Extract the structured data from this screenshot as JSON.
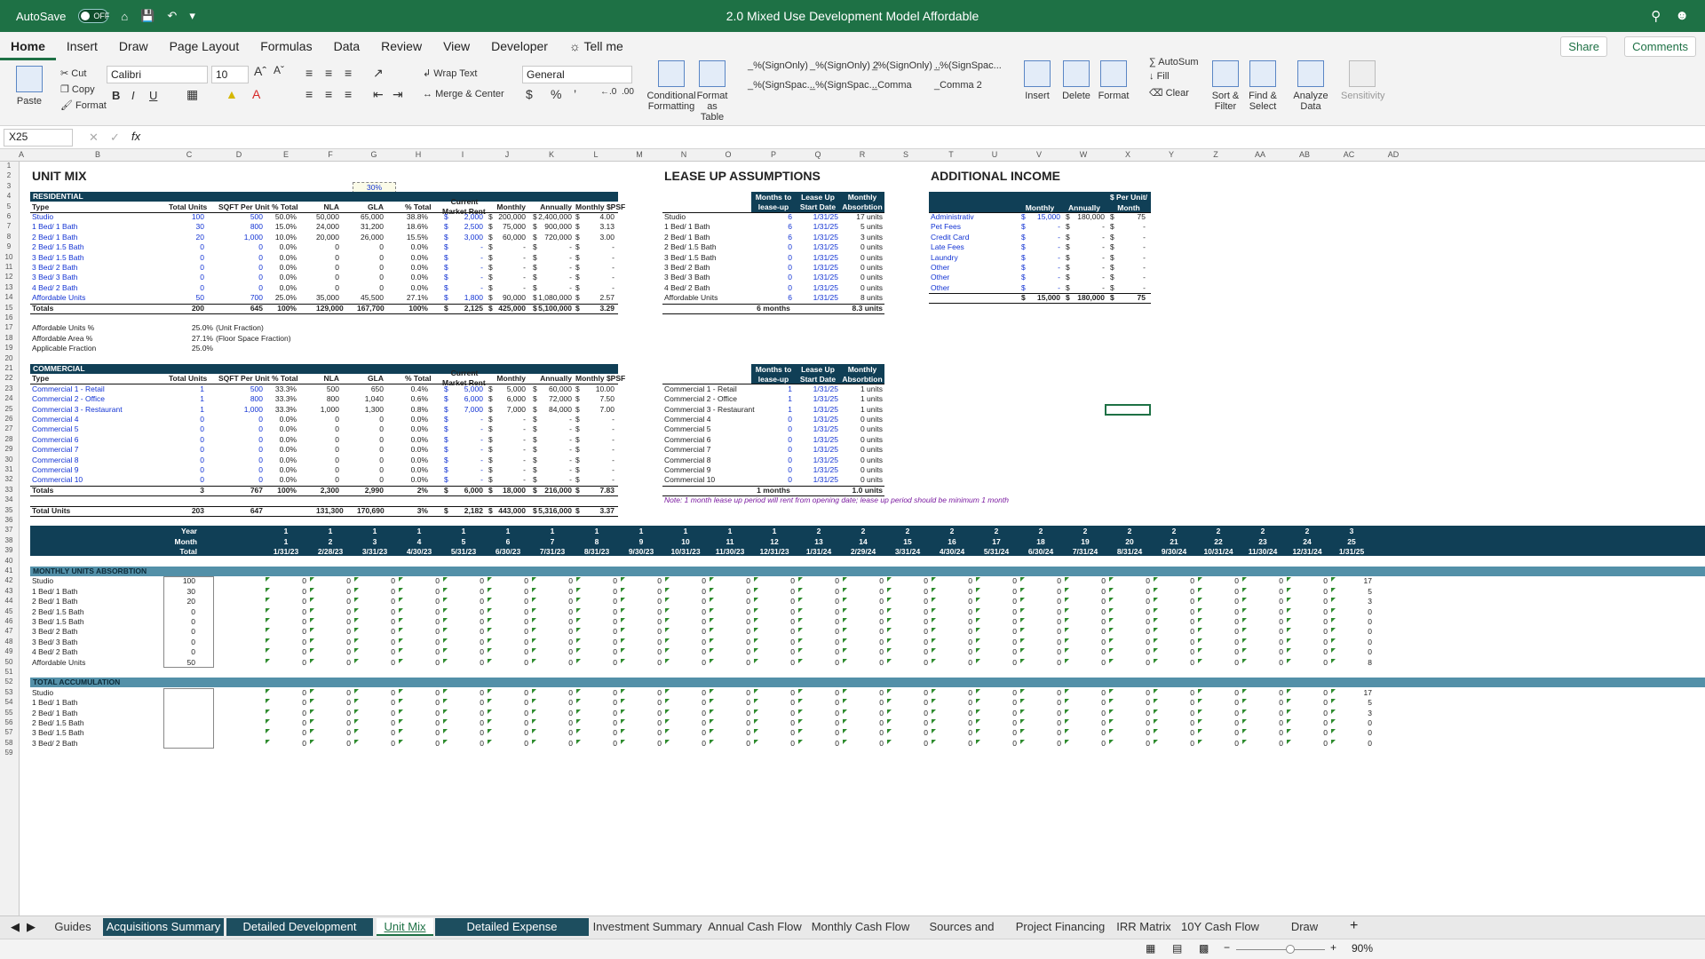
{
  "titlebar": {
    "autosave_label": "AutoSave",
    "autosave_state": "OFF",
    "document_title": "2.0 Mixed Use Development Model Affordable"
  },
  "menu": {
    "tabs": [
      "Home",
      "Insert",
      "Draw",
      "Page Layout",
      "Formulas",
      "Data",
      "Review",
      "View",
      "Developer"
    ],
    "tell_me": "Tell me",
    "share": "Share",
    "comments": "Comments"
  },
  "ribbon": {
    "paste": "Paste",
    "cut": "Cut",
    "copy": "Copy",
    "format": "Format",
    "font_name": "Calibri",
    "font_size": "10",
    "wrap_text": "Wrap Text",
    "merge_center": "Merge & Center",
    "number_format": "General",
    "conditional_formatting": [
      "Conditional",
      "Formatting"
    ],
    "format_as_table": [
      "Format",
      "as Table"
    ],
    "styles": [
      "_%(SignOnly)",
      "_%(SignOnly) 2",
      "_%(SignOnly) ...",
      "_%(SignSpac...",
      "_%(SignSpac...",
      "_%(SignSpac...",
      "_Comma",
      "_Comma 2"
    ],
    "insert": "Insert",
    "delete": "Delete",
    "format_cells": "Format",
    "autosum": "AutoSum",
    "fill": "Fill",
    "clear": "Clear",
    "sort_filter": [
      "Sort &",
      "Filter"
    ],
    "find_select": [
      "Find &",
      "Select"
    ],
    "analyze_data": [
      "Analyze",
      "Data"
    ],
    "sensitivity": "Sensitivity"
  },
  "formula_bar": {
    "name_box": "X25",
    "fx": "fx"
  },
  "columns": [
    "A",
    "B",
    "C",
    "D",
    "E",
    "F",
    "G",
    "H",
    "I",
    "J",
    "K",
    "L",
    "M",
    "N",
    "O",
    "P",
    "Q",
    "R",
    "S",
    "T",
    "U",
    "V",
    "W",
    "X",
    "Y",
    "Z",
    "AA",
    "AB",
    "AC",
    "AD"
  ],
  "sheet": {
    "unit_mix_title": "UNIT MIX",
    "pct_cell": "30%",
    "residential_band": "RESIDENTIAL",
    "res_headers": [
      "Type",
      "Total Units",
      "SQFT Per Unit",
      "% Total",
      "NLA",
      "GLA",
      "% Total",
      "Current Market Rent",
      "Monthly",
      "Annually",
      "Monthly $PSF"
    ],
    "res_rows": [
      [
        "Studio",
        "100",
        "500",
        "50.0%",
        "50,000",
        "65,000",
        "38.8%",
        "2,000",
        "200,000",
        "2,400,000",
        "4.00"
      ],
      [
        "1 Bed/ 1 Bath",
        "30",
        "800",
        "15.0%",
        "24,000",
        "31,200",
        "18.6%",
        "2,500",
        "75,000",
        "900,000",
        "3.13"
      ],
      [
        "2 Bed/ 1 Bath",
        "20",
        "1,000",
        "10.0%",
        "20,000",
        "26,000",
        "15.5%",
        "3,000",
        "60,000",
        "720,000",
        "3.00"
      ],
      [
        "2 Bed/ 1.5 Bath",
        "0",
        "0",
        "0.0%",
        "0",
        "0",
        "0.0%",
        "-",
        "-",
        "-",
        "-"
      ],
      [
        "3 Bed/ 1.5 Bath",
        "0",
        "0",
        "0.0%",
        "0",
        "0",
        "0.0%",
        "-",
        "-",
        "-",
        "-"
      ],
      [
        "3 Bed/ 2 Bath",
        "0",
        "0",
        "0.0%",
        "0",
        "0",
        "0.0%",
        "-",
        "-",
        "-",
        "-"
      ],
      [
        "3 Bed/ 3 Bath",
        "0",
        "0",
        "0.0%",
        "0",
        "0",
        "0.0%",
        "-",
        "-",
        "-",
        "-"
      ],
      [
        "4 Bed/ 2 Bath",
        "0",
        "0",
        "0.0%",
        "0",
        "0",
        "0.0%",
        "-",
        "-",
        "-",
        "-"
      ],
      [
        "Affordable Units",
        "50",
        "700",
        "25.0%",
        "35,000",
        "45,500",
        "27.1%",
        "1,800",
        "90,000",
        "1,080,000",
        "2.57"
      ]
    ],
    "res_totals": [
      "Totals",
      "200",
      "645",
      "100%",
      "129,000",
      "167,700",
      "100%",
      "2,125",
      "425,000",
      "5,100,000",
      "3.29"
    ],
    "afford_labels": [
      "Affordable Units %",
      "Affordable Area %",
      "Applicable Fraction"
    ],
    "afford_values": [
      "25.0%",
      "27.1%",
      "25.0%"
    ],
    "afford_notes": [
      "(Unit Fraction)",
      "(Floor Space Fraction)",
      ""
    ],
    "commercial_band": "COMMERCIAL",
    "com_rows": [
      [
        "Commercial 1 - Retail",
        "1",
        "500",
        "33.3%",
        "500",
        "650",
        "0.4%",
        "5,000",
        "5,000",
        "60,000",
        "10.00"
      ],
      [
        "Commercial 2 - Office",
        "1",
        "800",
        "33.3%",
        "800",
        "1,040",
        "0.6%",
        "6,000",
        "6,000",
        "72,000",
        "7.50"
      ],
      [
        "Commercial 3 - Restaurant",
        "1",
        "1,000",
        "33.3%",
        "1,000",
        "1,300",
        "0.8%",
        "7,000",
        "7,000",
        "84,000",
        "7.00"
      ],
      [
        "Commercial 4",
        "0",
        "0",
        "0.0%",
        "0",
        "0",
        "0.0%",
        "-",
        "-",
        "-",
        "-"
      ],
      [
        "Commercial 5",
        "0",
        "0",
        "0.0%",
        "0",
        "0",
        "0.0%",
        "-",
        "-",
        "-",
        "-"
      ],
      [
        "Commercial 6",
        "0",
        "0",
        "0.0%",
        "0",
        "0",
        "0.0%",
        "-",
        "-",
        "-",
        "-"
      ],
      [
        "Commercial 7",
        "0",
        "0",
        "0.0%",
        "0",
        "0",
        "0.0%",
        "-",
        "-",
        "-",
        "-"
      ],
      [
        "Commercial 8",
        "0",
        "0",
        "0.0%",
        "0",
        "0",
        "0.0%",
        "-",
        "-",
        "-",
        "-"
      ],
      [
        "Commercial 9",
        "0",
        "0",
        "0.0%",
        "0",
        "0",
        "0.0%",
        "-",
        "-",
        "-",
        "-"
      ],
      [
        "Commercial 10",
        "0",
        "0",
        "0.0%",
        "0",
        "0",
        "0.0%",
        "-",
        "-",
        "-",
        "-"
      ]
    ],
    "com_totals": [
      "Totals",
      "3",
      "767",
      "100%",
      "2,300",
      "2,990",
      "2%",
      "6,000",
      "18,000",
      "216,000",
      "7.83"
    ],
    "total_units": [
      "Total Units",
      "203",
      "647",
      "",
      "131,300",
      "170,690",
      "3%",
      "2,182",
      "443,000",
      "5,316,000",
      "3.37"
    ],
    "lease_title": "LEASE UP ASSUMPTIONS",
    "lease_headers": [
      "Months to lease-up",
      "Lease Up Start Date",
      "Monthly Absorbtion"
    ],
    "lease_rows": [
      [
        "Studio",
        "6",
        "1/31/25",
        "17 units"
      ],
      [
        "1 Bed/ 1 Bath",
        "6",
        "1/31/25",
        "5 units"
      ],
      [
        "2 Bed/ 1 Bath",
        "6",
        "1/31/25",
        "3 units"
      ],
      [
        "2 Bed/ 1.5 Bath",
        "0",
        "1/31/25",
        "0 units"
      ],
      [
        "3 Bed/ 1.5 Bath",
        "0",
        "1/31/25",
        "0 units"
      ],
      [
        "3 Bed/ 2 Bath",
        "0",
        "1/31/25",
        "0 units"
      ],
      [
        "3 Bed/ 3 Bath",
        "0",
        "1/31/25",
        "0 units"
      ],
      [
        "4 Bed/ 2 Bath",
        "0",
        "1/31/25",
        "0 units"
      ],
      [
        "Affordable Units",
        "6",
        "1/31/25",
        "8 units"
      ]
    ],
    "lease_totals": [
      "6 months",
      "8.3 units"
    ],
    "lease_com_rows": [
      [
        "Commercial 1 - Retail",
        "1",
        "1/31/25",
        "1 units"
      ],
      [
        "Commercial 2 - Office",
        "1",
        "1/31/25",
        "1 units"
      ],
      [
        "Commercial 3 - Restaurant",
        "1",
        "1/31/25",
        "1 units"
      ],
      [
        "Commercial 4",
        "0",
        "1/31/25",
        "0 units"
      ],
      [
        "Commercial 5",
        "0",
        "1/31/25",
        "0 units"
      ],
      [
        "Commercial 6",
        "0",
        "1/31/25",
        "0 units"
      ],
      [
        "Commercial 7",
        "0",
        "1/31/25",
        "0 units"
      ],
      [
        "Commercial 8",
        "0",
        "1/31/25",
        "0 units"
      ],
      [
        "Commercial 9",
        "0",
        "1/31/25",
        "0 units"
      ],
      [
        "Commercial 10",
        "0",
        "1/31/25",
        "0 units"
      ]
    ],
    "lease_com_totals": [
      "1 months",
      "1.0 units"
    ],
    "lease_note": "Note: 1 month lease up period will rent from opening date; lease up period should be minimum 1 month",
    "income_title": "ADDITIONAL INCOME",
    "income_headers": [
      "Monthly",
      "Annually",
      "$ Per Unit/ Month"
    ],
    "income_rows": [
      [
        "Administrativ",
        "15,000",
        "180,000",
        "75"
      ],
      [
        "Pet Fees",
        "-",
        "-",
        "-"
      ],
      [
        "Credit Card",
        "-",
        "-",
        "-"
      ],
      [
        "Late Fees",
        "-",
        "-",
        "-"
      ],
      [
        "Laundry",
        "-",
        "-",
        "-"
      ],
      [
        "Other",
        "-",
        "-",
        "-"
      ],
      [
        "Other",
        "-",
        "-",
        "-"
      ],
      [
        "Other",
        "-",
        "-",
        "-"
      ]
    ],
    "income_totals": [
      "15,000",
      "180,000",
      "75"
    ],
    "timeline_labels": [
      "Year",
      "Month",
      "Total"
    ],
    "timeline_years": [
      "1",
      "1",
      "1",
      "1",
      "1",
      "1",
      "1",
      "1",
      "1",
      "1",
      "1",
      "1",
      "2",
      "2",
      "2",
      "2",
      "2",
      "2",
      "2",
      "2",
      "2",
      "2",
      "2",
      "2",
      "3"
    ],
    "timeline_months": [
      "1",
      "2",
      "3",
      "4",
      "5",
      "6",
      "7",
      "8",
      "9",
      "10",
      "11",
      "12",
      "13",
      "14",
      "15",
      "16",
      "17",
      "18",
      "19",
      "20",
      "21",
      "22",
      "23",
      "24",
      "25"
    ],
    "timeline_dates": [
      "1/31/23",
      "2/28/23",
      "3/31/23",
      "4/30/23",
      "5/31/23",
      "6/30/23",
      "7/31/23",
      "8/31/23",
      "9/30/23",
      "10/31/23",
      "11/30/23",
      "12/31/23",
      "1/31/24",
      "2/29/24",
      "3/31/24",
      "4/30/24",
      "5/31/24",
      "6/30/24",
      "7/31/24",
      "8/31/24",
      "9/30/24",
      "10/31/24",
      "11/30/24",
      "12/31/24",
      "1/31/25"
    ],
    "absorption_band": "MONTHLY UNITS ABSORBTION",
    "absorption_rows": [
      [
        "Studio",
        "100",
        "17"
      ],
      [
        "1 Bed/ 1 Bath",
        "30",
        "5"
      ],
      [
        "2 Bed/ 1 Bath",
        "20",
        "3"
      ],
      [
        "2 Bed/ 1.5 Bath",
        "0",
        "0"
      ],
      [
        "3 Bed/ 1.5 Bath",
        "0",
        "0"
      ],
      [
        "3 Bed/ 2 Bath",
        "0",
        "0"
      ],
      [
        "3 Bed/ 3 Bath",
        "0",
        "0"
      ],
      [
        "4 Bed/ 2 Bath",
        "0",
        "0"
      ],
      [
        "Affordable Units",
        "50",
        "8"
      ]
    ],
    "accum_band": "TOTAL ACCUMULATION",
    "accum_rows": [
      [
        "Studio",
        "17"
      ],
      [
        "1 Bed/ 1 Bath",
        "5"
      ],
      [
        "2 Bed/ 1 Bath",
        "3"
      ],
      [
        "2 Bed/ 1.5 Bath",
        "0"
      ],
      [
        "3 Bed/ 1.5 Bath",
        "0"
      ],
      [
        "3 Bed/ 2 Bath",
        "0"
      ]
    ],
    "zero": "0",
    "dollar": "$"
  },
  "sheet_tabs": [
    "Guides",
    "Acquisitions Summary",
    "Detailed Development Budget",
    "Unit Mix",
    "Detailed Expense Assumptions",
    "Investment Summary",
    "Annual Cash Flow",
    "Monthly Cash Flow",
    "Sources and Uses",
    "Project Financing",
    "IRR Matrix",
    "10Y Cash Flow",
    "Draw Schedule"
  ],
  "status": {
    "zoom": "90%"
  },
  "colors": {
    "excel_green": "#1e7145",
    "navy_band": "#103f56",
    "light_band": "#5390a8",
    "input_blue": "#1233d3"
  },
  "icons": [
    "home-icon",
    "save-icon",
    "undo-icon",
    "search-icon",
    "profile-icon",
    "lightbulb-icon"
  ]
}
